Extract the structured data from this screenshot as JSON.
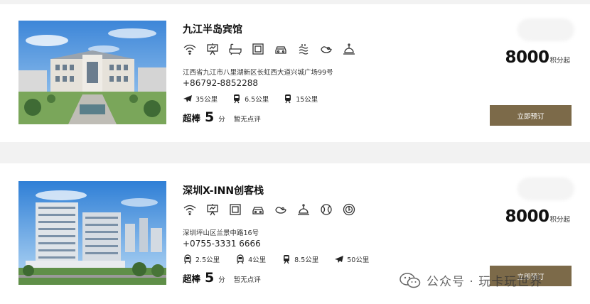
{
  "hotels": [
    {
      "name": "九江半岛宾馆",
      "amenities": [
        "wifi-icon",
        "presentation-icon",
        "bathtub-icon",
        "picture-frame-icon",
        "car-icon",
        "spa-icon",
        "dining-icon",
        "service-bell-icon"
      ],
      "address": "江西省九江市八里湖新区长虹西大道兴城广场99号",
      "phone": "+86792-8852288",
      "distances": [
        {
          "icon": "airplane-icon",
          "text": "35公里"
        },
        {
          "icon": "train-icon",
          "text": "6.5公里"
        },
        {
          "icon": "train-icon",
          "text": "15公里"
        }
      ],
      "rating_label": "超棒",
      "rating_score": "5",
      "rating_unit": "分",
      "review_text": "暂无点评",
      "price": "8000",
      "price_unit": "积分起",
      "book_label": "立即预订"
    },
    {
      "name": "深圳X-INN创客栈",
      "amenities": [
        "wifi-icon",
        "presentation-icon",
        "picture-frame-icon",
        "car-icon",
        "dining-icon",
        "service-bell-icon",
        "tennis-icon",
        "golf-icon"
      ],
      "address": "深圳坪山区兰景中路16号",
      "phone": "+0755-3331 6666",
      "distances": [
        {
          "icon": "subway-icon",
          "text": "2.5公里"
        },
        {
          "icon": "subway-icon",
          "text": "4公里"
        },
        {
          "icon": "train-icon",
          "text": "8.5公里"
        },
        {
          "icon": "airplane-icon",
          "text": "50公里"
        }
      ],
      "rating_label": "超棒",
      "rating_score": "5",
      "rating_unit": "分",
      "review_text": "暂无点评",
      "price": "8000",
      "price_unit": "积分起",
      "book_label": "立即预订"
    }
  ],
  "watermark": "公众号 · 玩卡玩世界",
  "colors": {
    "button": "#7c6a49",
    "background": "#f2f2f2",
    "card": "#ffffff"
  }
}
